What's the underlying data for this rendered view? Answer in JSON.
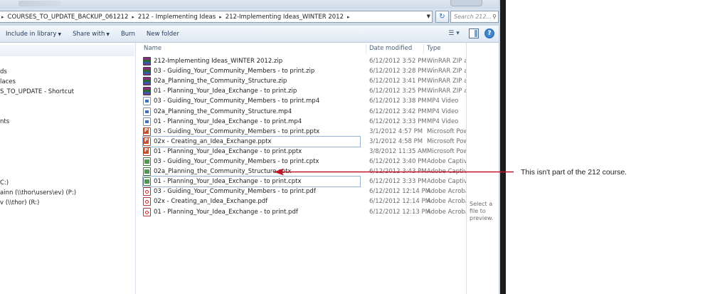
{
  "breadcrumb": [
    "COURSES_TO_UPDATE_BACKUP_061212",
    "212 - Implementing Ideas",
    "212-Implementing Ideas_WINTER 2012"
  ],
  "search": {
    "placeholder": "Search 212..."
  },
  "toolbar": {
    "include_library": "Include in library",
    "share_with": "Share with",
    "burn": "Burn",
    "new_folder": "New folder"
  },
  "nav": {
    "items": [
      "ds",
      "laces",
      "S_TO_UPDATE - Shortcut",
      "nts",
      "C:)",
      "ainn (\\\\thor\\users\\ev) (P:)",
      "v (\\\\thor) (R:)"
    ]
  },
  "columns": {
    "name": "Name",
    "date": "Date modified",
    "type": "Type"
  },
  "files": [
    {
      "name": "212-Implementing Ideas_WINTER 2012.zip",
      "date": "6/12/2012 3:52 PM",
      "type": "WinRAR ZIP archive",
      "icon": "zip-icon"
    },
    {
      "name": "03 - Guiding_Your_Community_Members - to print.zip",
      "date": "6/12/2012 3:28 PM",
      "type": "WinRAR ZIP archive",
      "icon": "zip-icon"
    },
    {
      "name": "02a_Planning_the_Community_Structure.zip",
      "date": "6/12/2012 3:41 PM",
      "type": "WinRAR ZIP archive",
      "icon": "zip-icon"
    },
    {
      "name": "01 - Planning_Your_Idea_Exchange - to print.zip",
      "date": "6/12/2012 3:25 PM",
      "type": "WinRAR ZIP archive",
      "icon": "zip-icon"
    },
    {
      "name": "03 - Guiding_Your_Community_Members - to print.mp4",
      "date": "6/12/2012 3:38 PM",
      "type": "MP4 Video",
      "icon": "video-icon"
    },
    {
      "name": "02a_Planning_the_Community_Structure.mp4",
      "date": "6/12/2012 3:42 PM",
      "type": "MP4 Video",
      "icon": "video-icon"
    },
    {
      "name": "01 - Planning_Your_Idea_Exchange - to print.mp4",
      "date": "6/12/2012 3:33 PM",
      "type": "MP4 Video",
      "icon": "video-icon"
    },
    {
      "name": "03 - Guiding_Your_Community_Members - to print.pptx",
      "date": "3/1/2012 4:57 PM",
      "type": "Microsoft PowerPoint",
      "icon": "powerpoint-icon"
    },
    {
      "name": "02x - Creating_an_Idea_Exchange.pptx",
      "date": "3/1/2012 4:58 PM",
      "type": "Microsoft PowerPoint",
      "icon": "powerpoint-icon"
    },
    {
      "name": "01 - Planning_Your_Idea_Exchange - to print.pptx",
      "date": "3/8/2012 11:35 AM",
      "type": "Microsoft PowerPoint",
      "icon": "powerpoint-icon"
    },
    {
      "name": "03 - Guiding_Your_Community_Members - to print.cptx",
      "date": "6/12/2012 3:40 PM",
      "type": "Adobe Captivate",
      "icon": "captivate-icon"
    },
    {
      "name": "02a_Planning_the_Community_Structure.cptx",
      "date": "6/12/2012 3:43 PM",
      "type": "Adobe Captivate",
      "icon": "captivate-icon"
    },
    {
      "name": "01 - Planning_Your_Idea_Exchange - to print.cptx",
      "date": "6/12/2012 3:33 PM",
      "type": "Adobe Captivate",
      "icon": "captivate-icon"
    },
    {
      "name": "03 - Guiding_Your_Community_Members - to print.pdf",
      "date": "6/12/2012 12:14 PM",
      "type": "Adobe Acrobat",
      "icon": "pdf-icon"
    },
    {
      "name": "02x - Creating_an_Idea_Exchange.pdf",
      "date": "6/12/2012 12:14 PM",
      "type": "Adobe Acrobat",
      "icon": "pdf-icon"
    },
    {
      "name": "01 - Planning_Your_Idea_Exchange - to print.pdf",
      "date": "6/12/2012 12:13 PM",
      "type": "Adobe Acrobat",
      "icon": "pdf-icon"
    }
  ],
  "preview": {
    "text": "Select a file to preview."
  },
  "annotation": {
    "text": "This isn't part of the 212 course.",
    "arrow_color": "#c0182a"
  }
}
